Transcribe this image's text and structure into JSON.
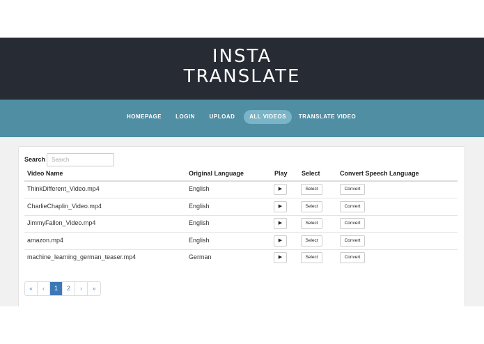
{
  "app": {
    "logo_line1": "INSTA",
    "logo_line2": "TRANSLATE"
  },
  "nav": {
    "items": [
      {
        "label": "HOMEPAGE",
        "active": false
      },
      {
        "label": "LOGIN",
        "active": false
      },
      {
        "label": "UPLOAD",
        "active": false
      },
      {
        "label": "ALL VIDEOS",
        "active": true
      },
      {
        "label": "TRANSLATE VIDEO",
        "active": false
      }
    ]
  },
  "search": {
    "label": "Search",
    "placeholder": "Search",
    "value": ""
  },
  "table": {
    "headers": [
      "Video Name",
      "Original Language",
      "Play",
      "Select",
      "Convert Speech Language"
    ],
    "play_icon": "play-icon",
    "select_label": "Select",
    "convert_label": "Convert",
    "rows": [
      {
        "name": "ThinkDifferent_Video.mp4",
        "language": "English"
      },
      {
        "name": "CharlieChaplin_Video.mp4",
        "language": "English"
      },
      {
        "name": "JimmyFallon_Video.mp4",
        "language": "English"
      },
      {
        "name": "amazon.mp4",
        "language": "English"
      },
      {
        "name": "machine_learning_german_teaser.mp4",
        "language": "German"
      }
    ]
  },
  "pagination": {
    "first": "«",
    "prev": "‹",
    "pages": [
      "1",
      "2"
    ],
    "current_page": "1",
    "next": "›",
    "last": "»"
  },
  "colors": {
    "header_bg": "#272b33",
    "nav_bg": "#4f8ea3",
    "nav_active_bg": "#7ab4c6",
    "pagination_active": "#3d78b6"
  }
}
